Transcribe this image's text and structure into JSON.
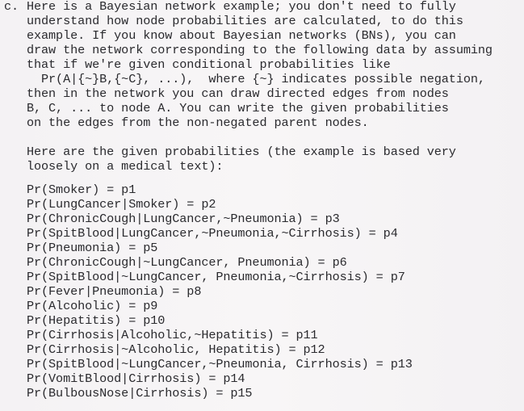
{
  "intro": {
    "label": "c.",
    "lines": [
      "Here is a Bayesian network example; you don't need to fully",
      "understand how node probabilities are calculated, to do this",
      "example. If you know about Bayesian networks (BNs), you can",
      "draw the network corresponding to the following data by assuming",
      "that if we're given conditional probabilities like",
      "  Pr(A|{~}B,{~C}, ...),  where {~} indicates possible negation,",
      "then in the network you can draw directed edges from nodes",
      "B, C, ... to node A. You can write the given probabilities",
      "on the edges from the non-negated parent nodes."
    ]
  },
  "given_intro": {
    "lines": [
      "Here are the given probabilities (the example is based very",
      "loosely on a medical text):"
    ]
  },
  "probabilities": [
    "Pr(Smoker) = p1",
    "Pr(LungCancer|Smoker) = p2",
    "Pr(ChronicCough|LungCancer,~Pneumonia) = p3",
    "Pr(SpitBlood|LungCancer,~Pneumonia,~Cirrhosis) = p4",
    "Pr(Pneumonia) = p5",
    "Pr(ChronicCough|~LungCancer, Pneumonia) = p6",
    "Pr(SpitBlood|~LungCancer, Pneumonia,~Cirrhosis) = p7",
    "Pr(Fever|Pneumonia) = p8",
    "Pr(Alcoholic) = p9",
    "Pr(Hepatitis) = p10",
    "Pr(Cirrhosis|Alcoholic,~Hepatitis) = p11",
    "Pr(Cirrhosis|~Alcoholic, Hepatitis) = p12",
    "Pr(SpitBlood|~LungCancer,~Pneumonia, Cirrhosis) = p13",
    "Pr(VomitBlood|Cirrhosis) = p14",
    "Pr(BulbousNose|Cirrhosis) = p15"
  ]
}
